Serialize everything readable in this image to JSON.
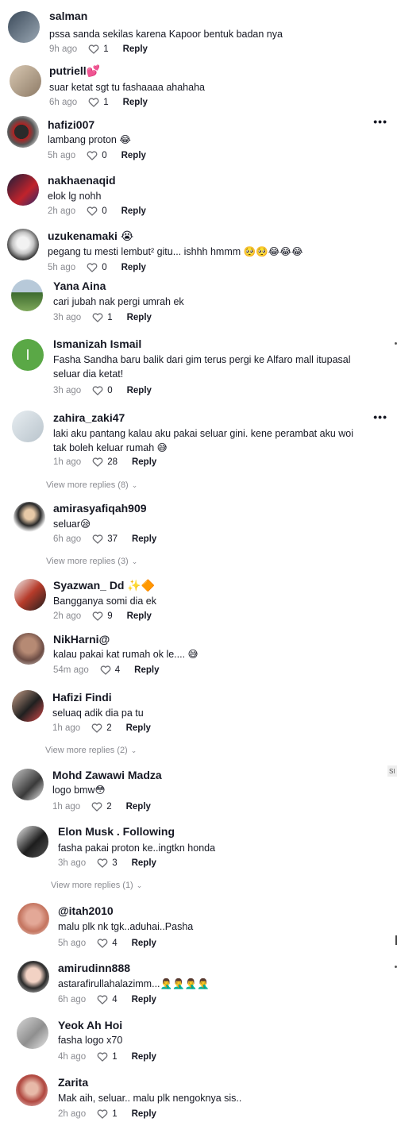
{
  "comments": [
    {
      "user": "salman",
      "text": "pssa sanda sekilas karena Kapoor bentuk badan nya",
      "time": "9h ago",
      "likes": "1",
      "reply": "Reply"
    },
    {
      "user": "putriell💕",
      "text": "suar ketat sgt tu fashaaaa ahahaha",
      "time": "6h ago",
      "likes": "1",
      "reply": "Reply"
    },
    {
      "user": "hafizi007",
      "text": "lambang proton 😂",
      "time": "5h ago",
      "likes": "0",
      "reply": "Reply"
    },
    {
      "user": "nakhaenaqid",
      "text": "elok lg nohh",
      "time": "2h ago",
      "likes": "0",
      "reply": "Reply"
    },
    {
      "user": "uzukenamaki 😭",
      "text": "pegang tu mesti lembut² gitu... ishhh hmmm 🥺🥺😂😂😂",
      "time": "5h ago",
      "likes": "0",
      "reply": "Reply"
    },
    {
      "user": "Yana Aina",
      "text": "cari jubah nak pergi umrah ek",
      "time": "3h ago",
      "likes": "1",
      "reply": "Reply"
    },
    {
      "user": "Ismanizah Ismail",
      "text": "Fasha Sandha baru balik dari gim terus pergi ke Alfaro mall itupasal seluar dia ketat!",
      "time": "3h ago",
      "likes": "0",
      "reply": "Reply",
      "avatar_letter": "I"
    },
    {
      "user": "zahira_zaki47",
      "text": "laki aku pantang kalau aku pakai seluar gini. kene perambat aku woi tak boleh keluar rumah 😅",
      "time": "1h ago",
      "likes": "28",
      "reply": "Reply",
      "more": "View more replies (8)"
    },
    {
      "user": "amirasyafiqah909",
      "text": "seluar😪",
      "time": "6h ago",
      "likes": "37",
      "reply": "Reply",
      "more": "View more replies (3)"
    },
    {
      "user": "Syazwan_ Dd ✨🔶",
      "text": "Bangganya somi dia ek",
      "time": "2h ago",
      "likes": "9",
      "reply": "Reply"
    },
    {
      "user": "NikHarni@",
      "text": "kalau pakai kat rumah ok le.... 😅",
      "time": "54m ago",
      "likes": "4",
      "reply": "Reply"
    },
    {
      "user": "Hafizi Findi",
      "text": "seluaq adik dia pa tu",
      "time": "1h ago",
      "likes": "2",
      "reply": "Reply",
      "more": "View more replies (2)"
    },
    {
      "user": "Mohd Zawawi Madza",
      "text": "logo bmw😳",
      "time": "1h ago",
      "likes": "2",
      "reply": "Reply"
    },
    {
      "user": "Elon Musk . Following",
      "text": "fasha pakai proton ke..ingtkn honda",
      "time": "3h ago",
      "likes": "3",
      "reply": "Reply",
      "more": "View more replies (1)"
    },
    {
      "user": "@itah2010",
      "text": "malu plk nk tgk..aduhai..Pasha",
      "time": "5h ago",
      "likes": "4",
      "reply": "Reply"
    },
    {
      "user": "amirudinn888",
      "text": "astarafirullahalazimm...🤦‍♂️🤦‍♂️🤦‍♂️🤦‍♂️",
      "time": "6h ago",
      "likes": "4",
      "reply": "Reply"
    },
    {
      "user": "Yeok Ah Hoi",
      "text": "fasha logo x70",
      "time": "4h ago",
      "likes": "1",
      "reply": "Reply"
    },
    {
      "user": "Zarita",
      "text": "Mak aih, seluar.. malu plk nengoknya sis..",
      "time": "2h ago",
      "likes": "1",
      "reply": "Reply"
    }
  ],
  "more_icon": "more-horizontal-icon",
  "heart_icon": "heart-outline-icon",
  "colors": {
    "text": "#161823",
    "muted": "#8a8b91",
    "avatar_letter_bg": "#5aa846"
  },
  "side_label": "SI"
}
